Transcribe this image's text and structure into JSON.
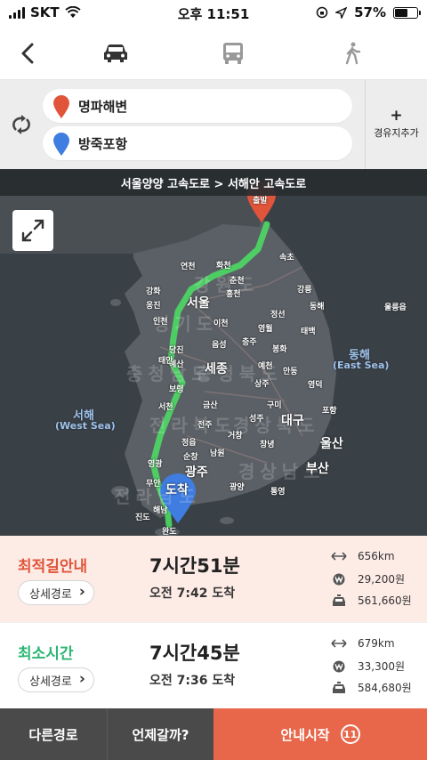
{
  "status_bar": {
    "carrier": "SKT",
    "time": "오후 11:51",
    "battery": "57%",
    "battery_level": 0.57
  },
  "nav": {
    "modes": [
      "car-icon",
      "bus-icon",
      "walk-icon"
    ],
    "selected_mode": "car"
  },
  "search": {
    "origin": "명파해변",
    "destination": "방죽포항",
    "waypoint_label": "경유지추가",
    "waypoint_plus": "+"
  },
  "map": {
    "route_banner": "서울양양 고속도로 > 서해안 고속도로",
    "start_marker": "출발",
    "end_marker": "도착",
    "region_labels": [
      "강원도",
      "경기도",
      "충청북도",
      "충청남도",
      "전라북도",
      "경상북도",
      "경상남도",
      "전라남도"
    ],
    "cities": [
      "연천",
      "화천",
      "속초",
      "춘천",
      "강화",
      "홍천",
      "강릉",
      "서울",
      "옹진",
      "정선",
      "동해",
      "인천",
      "이천",
      "영월",
      "태백",
      "울릉읍",
      "음성",
      "충주",
      "봉화",
      "당진",
      "세종",
      "예산",
      "예천",
      "안동",
      "태안",
      "영덕",
      "보령",
      "상주",
      "금산",
      "구미",
      "포항",
      "서천",
      "대구",
      "성주",
      "전주",
      "거창",
      "울산",
      "정읍",
      "창녕",
      "순창",
      "남원",
      "영광",
      "광주",
      "부산",
      "무안",
      "광양",
      "통영",
      "해남",
      "진도",
      "완도"
    ],
    "seas": {
      "east_kr": "동해",
      "east_en": "(East Sea)",
      "west_kr": "서해",
      "west_en": "(West Sea)"
    }
  },
  "routes": [
    {
      "name": "최적길안내",
      "color": "#e8664a",
      "detail": "상세경로",
      "duration": "7시간51분",
      "arrival": "오전 7:42 도착",
      "distance": "656km",
      "toll": "29,200원",
      "taxi": "561,660원"
    },
    {
      "name": "최소시간",
      "color": "#2bb673",
      "detail": "상세경로",
      "duration": "7시간45분",
      "arrival": "오전 7:36 도착",
      "distance": "679km",
      "toll": "33,300원",
      "taxi": "584,680원"
    }
  ],
  "bottom": {
    "alt_routes": "다른경로",
    "when": "언제갈까?",
    "start": "안내시작",
    "countdown": "11"
  }
}
